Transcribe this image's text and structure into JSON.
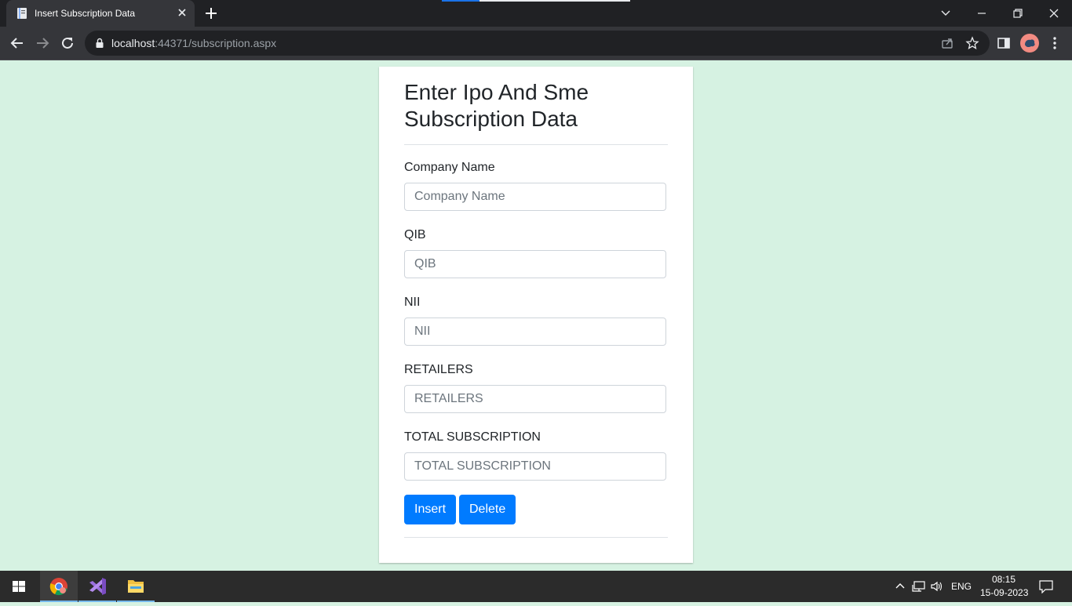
{
  "browser": {
    "tab_title": "Insert Subscription Data",
    "url_host": "localhost",
    "url_rest": ":44371/subscription.aspx"
  },
  "form": {
    "heading": "Enter Ipo And Sme Subscription Data",
    "fields": [
      {
        "label": "Company Name",
        "placeholder": "Company Name",
        "value": ""
      },
      {
        "label": "QIB",
        "placeholder": "QIB",
        "value": ""
      },
      {
        "label": "NII",
        "placeholder": "NII",
        "value": ""
      },
      {
        "label": "RETAILERS",
        "placeholder": "RETAILERS",
        "value": ""
      },
      {
        "label": "TOTAL SUBSCRIPTION",
        "placeholder": "TOTAL SUBSCRIPTION",
        "value": ""
      }
    ],
    "insert_label": "Insert",
    "delete_label": "Delete"
  },
  "taskbar": {
    "language": "ENG",
    "time": "08:15",
    "date": "15-09-2023"
  },
  "colors": {
    "page_background": "#d6f2e2",
    "primary_button": "#007bff"
  },
  "icons": {
    "tab": [
      "document-icon",
      "close-icon",
      "plus-icon"
    ],
    "window": [
      "chevron-down-icon",
      "minimize-icon",
      "restore-icon",
      "close-icon"
    ],
    "toolbar": [
      "back-arrow-icon",
      "forward-arrow-icon",
      "reload-icon",
      "lock-icon",
      "share-icon",
      "star-icon",
      "side-panel-icon",
      "avatar",
      "kebab-menu-icon"
    ],
    "taskbar": [
      "windows-start-icon",
      "chrome-icon",
      "visual-studio-icon",
      "file-explorer-icon",
      "chevron-up-icon",
      "network-icon",
      "volume-icon",
      "notification-icon"
    ]
  }
}
